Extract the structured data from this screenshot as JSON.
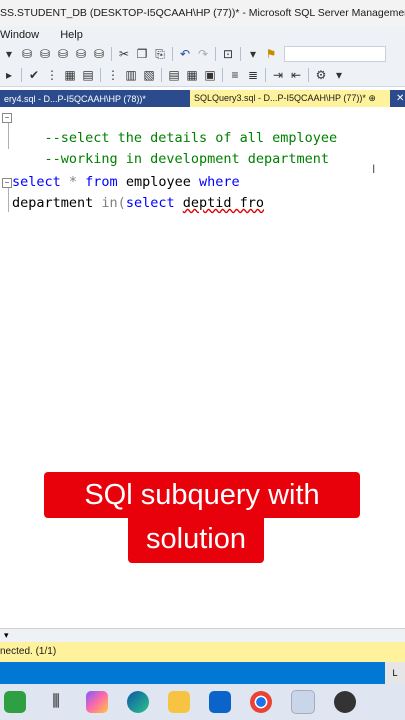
{
  "window": {
    "title": "SS.STUDENT_DB (DESKTOP-I5QCAAH\\HP (77))* - Microsoft SQL Server Management Studio"
  },
  "menu": {
    "items": [
      "Window",
      "Help"
    ]
  },
  "tabs": [
    {
      "label": "ery4.sql - D...P-I5QCAAH\\HP (78))*",
      "active": false
    },
    {
      "label": "SQLQuery3.sql - D...P-I5QCAAH\\HP (77))*",
      "active": true,
      "pin": "⊕"
    }
  ],
  "tab_close": "✕",
  "editor": {
    "comment1": "--select the details of all employee",
    "comment2": "--working in development department",
    "line3": {
      "kw_select": "select",
      "star": " * ",
      "kw_from": "from",
      "table": " employee ",
      "kw_where": "where"
    },
    "line4": {
      "col": "department ",
      "kw_in": "in",
      "paren": "(",
      "kw_select": "select",
      "space": " ",
      "ident": "deptid",
      "rest": " fro"
    },
    "cursor_glyph": "I"
  },
  "caption": {
    "line1": "SQl subquery with",
    "line2": "solution"
  },
  "status": {
    "text": "nected. (1/1)"
  },
  "taskbar_corner": "L",
  "colors": {
    "comment": "#008000",
    "keyword": "#0000ff",
    "tab_active": "#fff29d",
    "tabstrip": "#2b4b8c",
    "caption_bg": "#e8000b",
    "statusbar": "#fff29d",
    "accent": "#0078d4"
  }
}
